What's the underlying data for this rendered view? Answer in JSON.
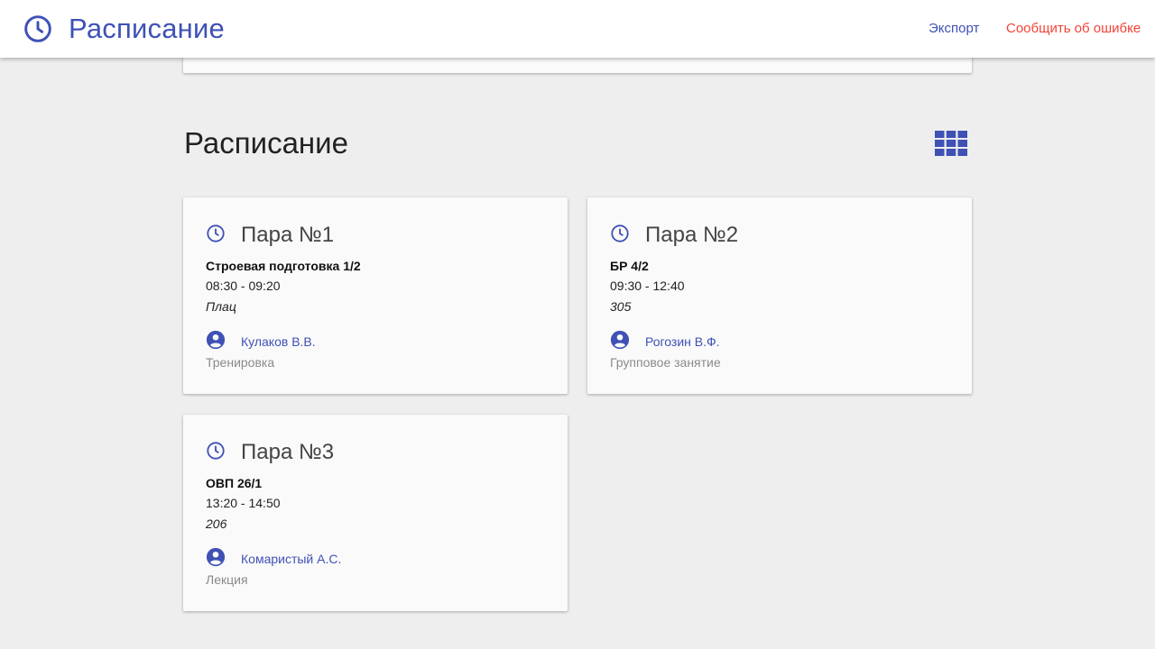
{
  "appbar": {
    "title": "Расписание",
    "logo_icon": "clock-icon",
    "nav_export": "Экспорт",
    "nav_report": "Сообщить об ошибке"
  },
  "section": {
    "title": "Расписание",
    "view_toggle_icon": "grid-view-icon"
  },
  "colors": {
    "primary": "#3f51b5",
    "danger": "#f44336",
    "background": "#eeeeee",
    "card": "#fafafa"
  },
  "lessons": [
    {
      "heading": "Пара №1",
      "subject": "Строевая подготовка 1/2",
      "time": "08:30 - 09:20",
      "room": "Плац",
      "teacher": "Кулаков В.В.",
      "kind": "Тренировка"
    },
    {
      "heading": "Пара №2",
      "subject": "БР 4/2",
      "time": "09:30 - 12:40",
      "room": "305",
      "teacher": "Рогозин В.Ф.",
      "kind": "Групповое занятие"
    },
    {
      "heading": "Пара №3",
      "subject": "ОВП 26/1",
      "time": "13:20 - 14:50",
      "room": "206",
      "teacher": "Комаристый А.С.",
      "kind": "Лекция"
    }
  ]
}
